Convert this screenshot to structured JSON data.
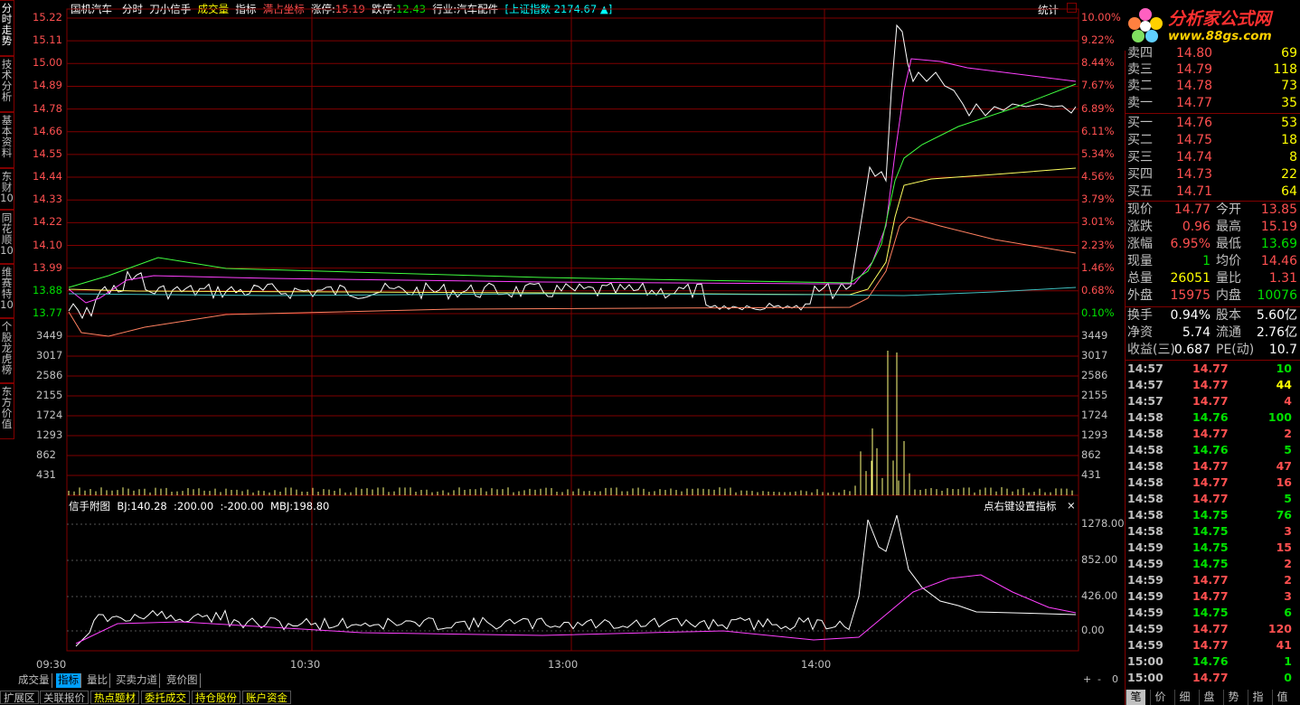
{
  "header": {
    "stock_name": "国机汽车",
    "mode": "分时",
    "indicator_name": "刀小信手",
    "volume_label": "成交量",
    "indicator_label": "指标",
    "full_axis": "满占坐标",
    "limit_up_label": "涨停:",
    "limit_up": "15.19",
    "limit_down_label": "跌停:",
    "limit_down": "12.43",
    "industry": "行业:汽车配件",
    "index_label": "[上证指数",
    "index_value": "2174.67",
    "index_arrow": "▲]",
    "stats": "统计"
  },
  "left_tabs": [
    {
      "label": "分时走势",
      "active": true
    },
    {
      "label": "技术分析",
      "active": false
    },
    {
      "label": "基本资料",
      "active": false
    },
    {
      "label": "东财10",
      "active": false
    },
    {
      "label": "同花顺10",
      "active": false
    },
    {
      "label": "维赛特10",
      "active": false
    },
    {
      "label": "个股龙虎榜",
      "active": false
    },
    {
      "label": "东方价值",
      "active": false
    }
  ],
  "price_axis": [
    "15.22",
    "15.11",
    "15.00",
    "14.89",
    "14.78",
    "14.66",
    "14.55",
    "14.44",
    "14.33",
    "14.22",
    "14.10",
    "13.99",
    "13.88",
    "13.77"
  ],
  "pct_axis": [
    "10.00%",
    "9.22%",
    "8.44%",
    "7.67%",
    "6.89%",
    "6.11%",
    "5.34%",
    "4.56%",
    "3.79%",
    "3.01%",
    "2.23%",
    "1.46%",
    "0.68%",
    "0.10%"
  ],
  "vol_axis": [
    "3449",
    "3017",
    "2586",
    "2155",
    "1724",
    "1293",
    "862",
    "431"
  ],
  "sub_panel": {
    "title": "信手附图",
    "bj": "BJ:140.28",
    "v1": ":200.00",
    "v2": ":-200.00",
    "mbj": "MBJ:198.80",
    "right_hint": "点右键设置指标",
    "close": "×",
    "axis": [
      "1278.00",
      "852.00",
      "426.00",
      "0.00"
    ]
  },
  "time_axis": [
    "09:30",
    "10:30",
    "13:00",
    "14:00"
  ],
  "bottom_tabs": [
    {
      "label": "成交量",
      "on": false
    },
    {
      "label": "指标",
      "on": true
    },
    {
      "label": "量比",
      "on": false
    },
    {
      "label": "买卖力道",
      "on": false
    },
    {
      "label": "竞价图",
      "on": false
    }
  ],
  "zoom_controls": [
    "+",
    "-",
    "0"
  ],
  "footer_tabs": [
    {
      "label": "扩展区",
      "hl": false
    },
    {
      "label": "关联报价",
      "hl": false
    },
    {
      "label": "热点题材",
      "hl": true
    },
    {
      "label": "委托成交",
      "hl": true
    },
    {
      "label": "持仓股份",
      "hl": true
    },
    {
      "label": "账户资金",
      "hl": true
    }
  ],
  "logo": {
    "name": "分析家公式网",
    "url": "www.88gs.com"
  },
  "orderbook": {
    "sell": [
      {
        "name": "卖四",
        "price": "14.80",
        "vol": "69"
      },
      {
        "name": "卖三",
        "price": "14.79",
        "vol": "118"
      },
      {
        "name": "卖二",
        "price": "14.78",
        "vol": "73"
      },
      {
        "name": "卖一",
        "price": "14.77",
        "vol": "35"
      }
    ],
    "buy": [
      {
        "name": "买一",
        "price": "14.76",
        "vol": "53"
      },
      {
        "name": "买二",
        "price": "14.75",
        "vol": "18"
      },
      {
        "name": "买三",
        "price": "14.74",
        "vol": "8"
      },
      {
        "name": "买四",
        "price": "14.73",
        "vol": "22"
      },
      {
        "name": "买五",
        "price": "14.71",
        "vol": "64"
      }
    ]
  },
  "quote": [
    {
      "l1": "现价",
      "v1": "14.77",
      "l2": "今开",
      "v2": "13.85"
    },
    {
      "l1": "涨跌",
      "v1": "0.96",
      "l2": "最高",
      "v2": "15.19"
    },
    {
      "l1": "涨幅",
      "v1": "6.95%",
      "l2": "最低",
      "v2": "13.69"
    },
    {
      "l1": "现量",
      "v1": "1",
      "l2": "均价",
      "v2": "14.46"
    },
    {
      "l1": "总量",
      "v1": "26051",
      "l2": "量比",
      "v2": "1.31"
    },
    {
      "l1": "外盘",
      "v1": "15975",
      "l2": "内盘",
      "v2": "10076"
    }
  ],
  "fundamentals": [
    {
      "l1": "换手",
      "v1": "0.94%",
      "l2": "股本",
      "v2": "5.60亿"
    },
    {
      "l1": "净资",
      "v1": "5.74",
      "l2": "流通",
      "v2": "2.76亿"
    },
    {
      "l1": "收益(三)",
      "v1": "0.687",
      "l2": "PE(动)",
      "v2": "10.7"
    }
  ],
  "ticks": [
    {
      "t": "14:57",
      "p": "14.77",
      "v": "10",
      "c": "grn"
    },
    {
      "t": "14:57",
      "p": "14.77",
      "v": "44",
      "c": "yel"
    },
    {
      "t": "14:57",
      "p": "14.77",
      "v": "4",
      "c": "red"
    },
    {
      "t": "14:58",
      "p": "14.76",
      "v": "100",
      "c": "grn"
    },
    {
      "t": "14:58",
      "p": "14.77",
      "v": "2",
      "c": "red"
    },
    {
      "t": "14:58",
      "p": "14.76",
      "v": "5",
      "c": "grn"
    },
    {
      "t": "14:58",
      "p": "14.77",
      "v": "47",
      "c": "red"
    },
    {
      "t": "14:58",
      "p": "14.77",
      "v": "16",
      "c": "red"
    },
    {
      "t": "14:58",
      "p": "14.77",
      "v": "5",
      "c": "grn"
    },
    {
      "t": "14:58",
      "p": "14.75",
      "v": "76",
      "c": "grn"
    },
    {
      "t": "14:58",
      "p": "14.75",
      "v": "3",
      "c": "red"
    },
    {
      "t": "14:59",
      "p": "14.75",
      "v": "15",
      "c": "red"
    },
    {
      "t": "14:59",
      "p": "14.75",
      "v": "2",
      "c": "red"
    },
    {
      "t": "14:59",
      "p": "14.77",
      "v": "2",
      "c": "red"
    },
    {
      "t": "14:59",
      "p": "14.77",
      "v": "3",
      "c": "red"
    },
    {
      "t": "14:59",
      "p": "14.75",
      "v": "6",
      "c": "grn"
    },
    {
      "t": "14:59",
      "p": "14.77",
      "v": "120",
      "c": "red"
    },
    {
      "t": "14:59",
      "p": "14.77",
      "v": "41",
      "c": "red"
    },
    {
      "t": "15:00",
      "p": "14.76",
      "v": "1",
      "c": "grn"
    },
    {
      "t": "15:00",
      "p": "14.77",
      "v": "0",
      "c": "grn"
    }
  ],
  "right_tabs": [
    {
      "label": "笔",
      "on": true
    },
    {
      "label": "价",
      "on": false
    },
    {
      "label": "细",
      "on": false
    },
    {
      "label": "盘",
      "on": false
    },
    {
      "label": "势",
      "on": false
    },
    {
      "label": "指",
      "on": false
    },
    {
      "label": "值",
      "on": false
    }
  ],
  "colors": {
    "grid": "#800000",
    "up": "#ff5050",
    "down": "#00e000",
    "price_line": "#ffffff",
    "avg_line": "#ffff00"
  }
}
